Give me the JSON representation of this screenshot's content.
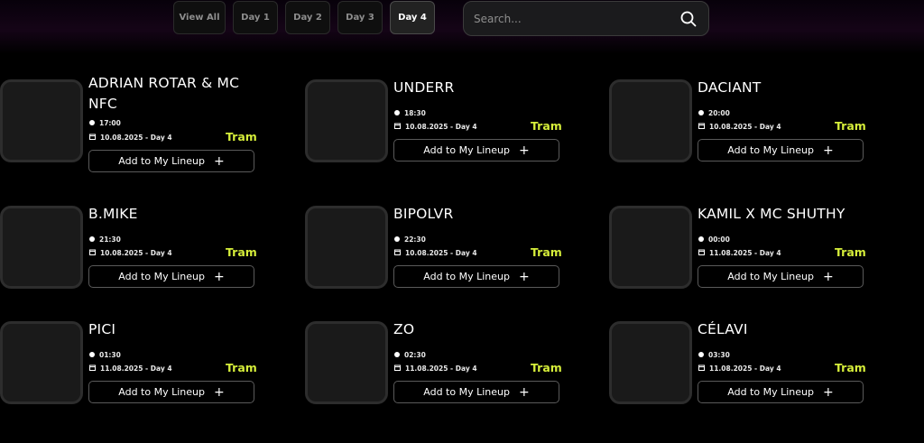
{
  "filters": [
    "View All",
    "Day 1",
    "Day 2",
    "Day 3",
    "Day 4"
  ],
  "active_filter": "Day 4",
  "search": {
    "placeholder": "Search..."
  },
  "add_label": "Add to My Lineup",
  "add_plus": "+",
  "colors": {
    "accent": "#d6ee3a",
    "background": "#000000"
  },
  "artists": [
    {
      "name": "ADRIAN ROTAR & MC NFC",
      "time": "17:00",
      "date": "10.08.2025 - Day 4",
      "stage": "Tram",
      "photo": "duo-bw"
    },
    {
      "name": "UNDERR",
      "time": "18:30",
      "date": "10.08.2025 - Day 4",
      "stage": "Tram",
      "photo": "glasses-navy"
    },
    {
      "name": "DACIANT",
      "time": "20:00",
      "date": "10.08.2025 - Day 4",
      "stage": "Tram",
      "photo": "dark-headphones"
    },
    {
      "name": "B.MIKE",
      "time": "21:30",
      "date": "10.08.2025 - Day 4",
      "stage": "Tram",
      "photo": "raised-hands"
    },
    {
      "name": "BIPOLVR",
      "time": "22:30",
      "date": "10.08.2025 - Day 4",
      "stage": "Tram",
      "photo": "sunglasses-dark"
    },
    {
      "name": "KAMIL X MC SHUTHY",
      "time": "00:00",
      "date": "11.08.2025 - Day 4",
      "stage": "Tram",
      "photo": "duo-bw"
    },
    {
      "name": "PICI",
      "time": "01:30",
      "date": "11.08.2025 - Day 4",
      "stage": "Tram",
      "photo": "shirt-pici"
    },
    {
      "name": "ZO",
      "time": "02:30",
      "date": "11.08.2025 - Day 4",
      "stage": "Tram",
      "photo": "stage-dj"
    },
    {
      "name": "CÉLAVI",
      "time": "03:30",
      "date": "11.08.2025 - Day 4",
      "stage": "Tram",
      "photo": "black-shirt"
    }
  ]
}
